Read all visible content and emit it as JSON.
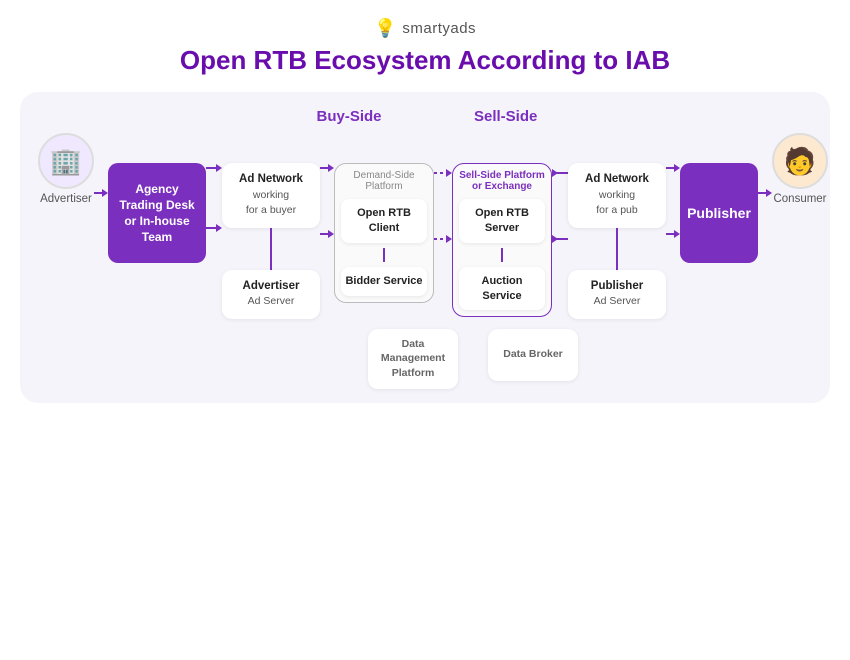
{
  "logo": {
    "icon": "💡",
    "text": "smartyads"
  },
  "title": "Open RTB Ecosystem According to IAB",
  "sections": {
    "buy_side": "Buy-Side",
    "sell_side": "Sell-Side"
  },
  "advertiser": {
    "icon": "🏢",
    "label": "Advertiser"
  },
  "consumer": {
    "icon": "👤",
    "label": "Consumer"
  },
  "agency_box": {
    "line1": "Agency",
    "line2": "Trading Desk",
    "line3": "or In-house",
    "line4": "Team"
  },
  "publisher_box": {
    "label": "Publisher"
  },
  "ad_network_buy": {
    "main": "Ad Network",
    "sub1": "working",
    "sub2": "for a buyer"
  },
  "advertiser_ad_server": {
    "main": "Advertiser",
    "sub": "Ad Server"
  },
  "dsp": {
    "label": "Demand-Side Platform",
    "open_rtb_client": "Open RTB Client",
    "bidder_service": "Bidder Service"
  },
  "ssp": {
    "label1": "Sell-Side Platform",
    "label2": "or Exchange",
    "open_rtb_server": "Open RTB Server",
    "auction_service": "Auction Service"
  },
  "ad_network_sell": {
    "main": "Ad Network",
    "sub1": "working",
    "sub2": "for a pub"
  },
  "publisher_ad_server": {
    "main": "Publisher",
    "sub": "Ad Server"
  },
  "data_row": {
    "dmp": {
      "line1": "Data",
      "line2": "Management",
      "line3": "Platform"
    },
    "data_broker": "Data Broker"
  }
}
